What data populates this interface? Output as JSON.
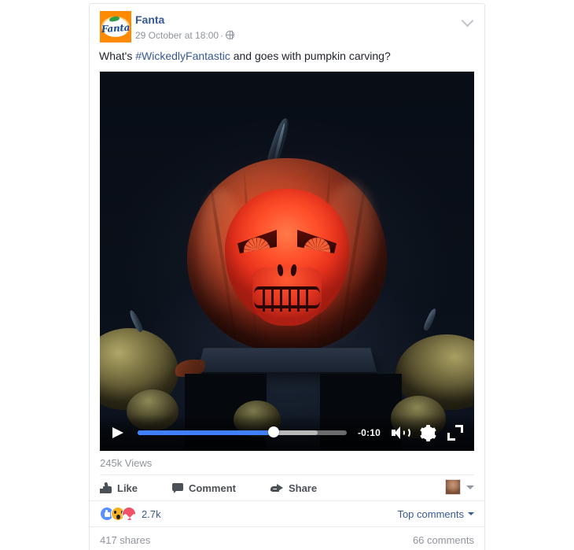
{
  "post": {
    "page_name": "Fanta",
    "timestamp": "29 October at 18:00",
    "meta_separator": "·",
    "privacy_icon": "globe-icon",
    "menu_icon": "chevron-down-icon",
    "message_prefix": "What's ",
    "hashtag": "#WickedlyFantastic",
    "message_suffix": " and goes with pumpkin carving?"
  },
  "video": {
    "alt": "Carved pumpkin with glowing red skull face",
    "play_icon": "play-icon",
    "time_remaining": "-0:10",
    "progress_percent": 65,
    "buffer_percent": 86,
    "volume_icon": "volume-icon",
    "settings_icon": "gear-icon",
    "fullscreen_icon": "fullscreen-icon",
    "views": "245k Views"
  },
  "actions": {
    "like_label": "Like",
    "like_icon": "thumbs-up-icon",
    "comment_label": "Comment",
    "comment_icon": "comment-bubble-icon",
    "share_label": "Share",
    "share_icon": "share-arrow-icon",
    "viewer_avatar": "user-avatar",
    "viewer_caret": "caret-down-icon"
  },
  "reactions": {
    "badges": [
      "like-reaction",
      "wow-reaction",
      "love-reaction"
    ],
    "count": "2.7k",
    "sort_label": "Top comments"
  },
  "footer": {
    "shares": "417 shares",
    "comments": "66 comments"
  },
  "colors": {
    "fb_blue": "#365899",
    "accent_blue": "#4080ff",
    "brand_orange": "#ff8a00",
    "text_dark": "#1d2129",
    "text_muted": "#90949c"
  }
}
